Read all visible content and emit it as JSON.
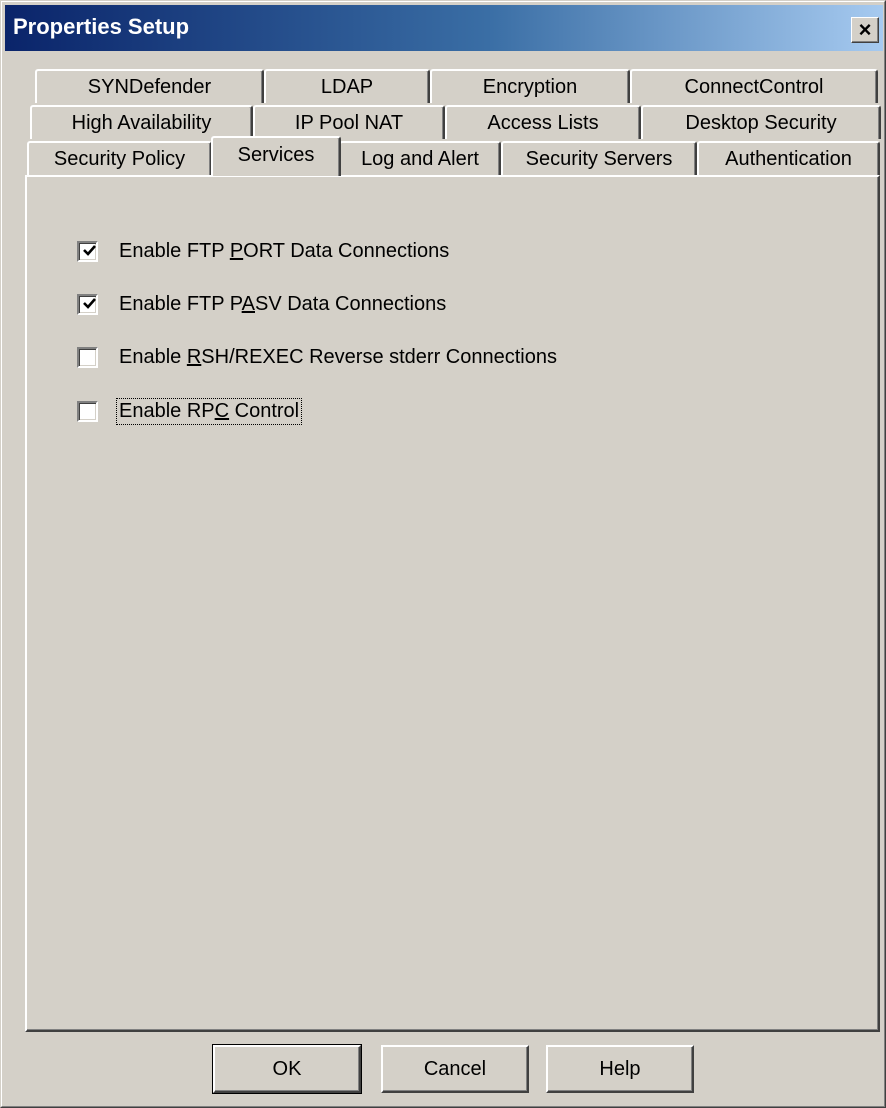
{
  "window": {
    "title": "Properties Setup",
    "close_label": "×"
  },
  "tabs": {
    "row1": [
      "SYNDefender",
      "LDAP",
      "Encryption",
      "ConnectControl"
    ],
    "row2": [
      "High Availability",
      "IP Pool NAT",
      "Access Lists",
      "Desktop Security"
    ],
    "row3": [
      "Security Policy",
      "Services",
      "Log and Alert",
      "Security Servers",
      "Authentication"
    ],
    "active": "Services"
  },
  "services": {
    "options": [
      {
        "before": "Enable FTP ",
        "mnemonic": "P",
        "after": "ORT Data Connections",
        "checked": true
      },
      {
        "before": "Enable FTP P",
        "mnemonic": "A",
        "after": "SV Data Connections",
        "checked": true
      },
      {
        "before": "Enable ",
        "mnemonic": "R",
        "after": "SH/REXEC Reverse stderr Connections",
        "checked": false
      },
      {
        "before": "Enable RP",
        "mnemonic": "C",
        "after": " Control",
        "checked": false,
        "focused": true
      }
    ]
  },
  "buttons": {
    "ok": "OK",
    "cancel": "Cancel",
    "help": "Help"
  }
}
